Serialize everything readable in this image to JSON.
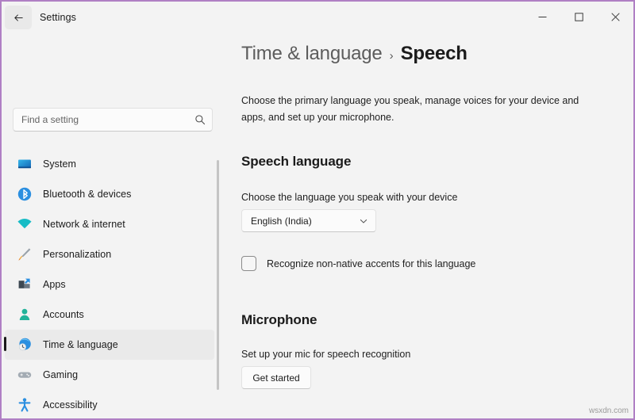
{
  "window": {
    "app_title": "Settings",
    "back_icon": "back-arrow-icon",
    "controls": {
      "minimize": "minimize-icon",
      "maximize": "maximize-icon",
      "close": "close-icon"
    },
    "accent_border": "#b07fc4",
    "background": "#f3f3f3"
  },
  "search": {
    "placeholder": "Find a setting",
    "value": "",
    "icon": "search-icon"
  },
  "sidebar": {
    "items": [
      {
        "label": "System",
        "icon": "monitor-icon",
        "selected": false,
        "color": "#1b8fd4"
      },
      {
        "label": "Bluetooth & devices",
        "icon": "bluetooth-icon",
        "selected": false,
        "color": "#2b8fe0"
      },
      {
        "label": "Network & internet",
        "icon": "wifi-icon",
        "selected": false,
        "color": "#14b8c4"
      },
      {
        "label": "Personalization",
        "icon": "paintbrush-icon",
        "selected": false,
        "color": "#e8a33d"
      },
      {
        "label": "Apps",
        "icon": "apps-icon",
        "selected": false,
        "color": "#4a5560"
      },
      {
        "label": "Accounts",
        "icon": "person-icon",
        "selected": false,
        "color": "#22b39a"
      },
      {
        "label": "Time & language",
        "icon": "globe-clock-icon",
        "selected": true,
        "color": "#2b8fe0"
      },
      {
        "label": "Gaming",
        "icon": "gamepad-icon",
        "selected": false,
        "color": "#9aa3ab"
      },
      {
        "label": "Accessibility",
        "icon": "accessibility-icon",
        "selected": false,
        "color": "#2b8fe0"
      }
    ]
  },
  "content": {
    "breadcrumb": {
      "parent": "Time & language",
      "separator": "›",
      "current": "Speech"
    },
    "description": "Choose the primary language you speak, manage voices for your device and apps, and set up your microphone.",
    "speech_language": {
      "title": "Speech language",
      "subtitle": "Choose the language you speak with your device",
      "dropdown_value": "English (India)",
      "dropdown_icon": "chevron-down-icon",
      "checkbox_label": "Recognize non-native accents for this language",
      "checkbox_checked": false
    },
    "microphone": {
      "title": "Microphone",
      "subtitle": "Set up your mic for speech recognition",
      "button_label": "Get started"
    }
  },
  "watermark": "wsxdn.com"
}
